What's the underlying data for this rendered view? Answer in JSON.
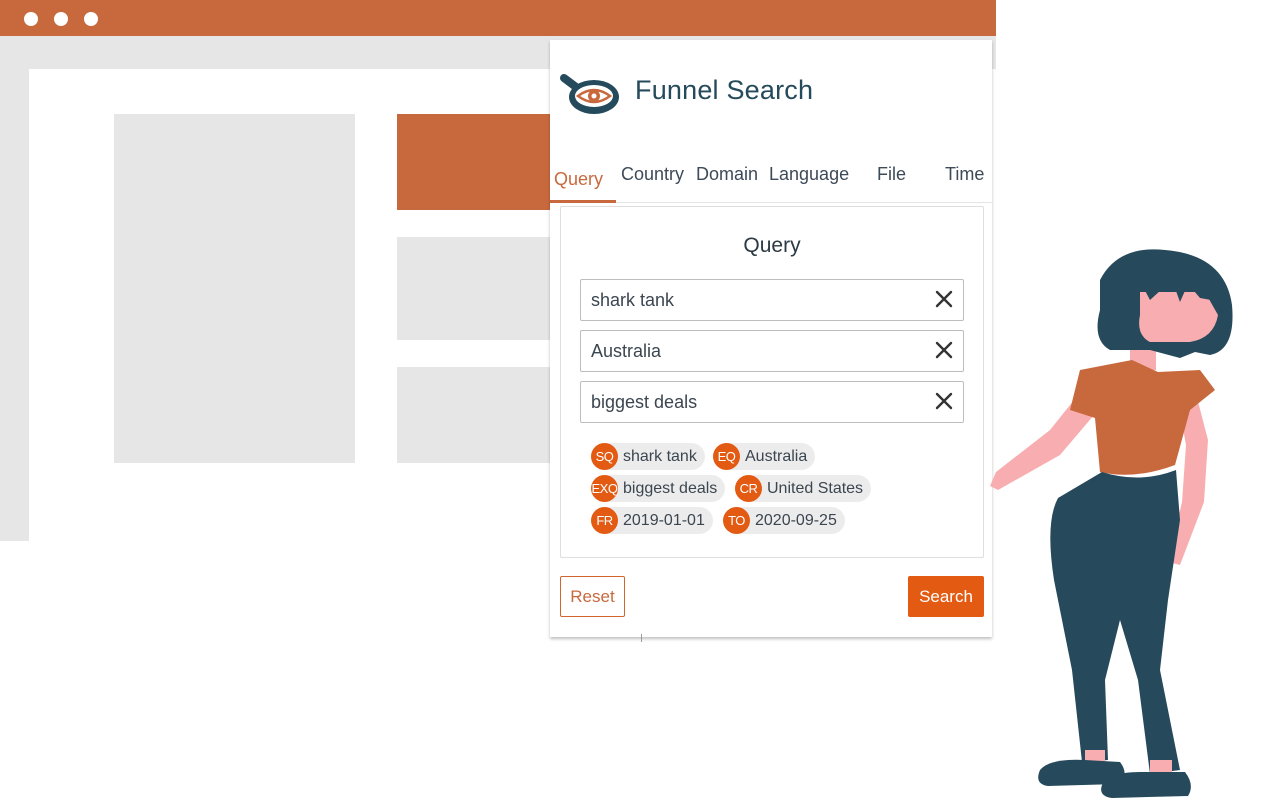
{
  "app": {
    "title": "Funnel Search"
  },
  "tabs": [
    {
      "label": "Query",
      "active": true
    },
    {
      "label": "Country",
      "active": false
    },
    {
      "label": "Domain",
      "active": false
    },
    {
      "label": "Language",
      "active": false
    },
    {
      "label": "File",
      "active": false
    },
    {
      "label": "Time",
      "active": false
    }
  ],
  "panel": {
    "title": "Query",
    "fields": [
      {
        "value": "shark tank"
      },
      {
        "value": "Australia"
      },
      {
        "value": "biggest deals"
      }
    ],
    "chips": [
      {
        "badge": "SQ",
        "label": "shark tank"
      },
      {
        "badge": "EQ",
        "label": "Australia"
      },
      {
        "badge": "EXQ",
        "label": "biggest deals"
      },
      {
        "badge": "CR",
        "label": "United States"
      },
      {
        "badge": "FR",
        "label": "2019-01-01"
      },
      {
        "badge": "TO",
        "label": "2020-09-25"
      }
    ]
  },
  "actions": {
    "reset_label": "Reset",
    "search_label": "Search"
  },
  "colors": {
    "accent": "#c8693d",
    "button": "#e35a12",
    "title_text": "#244a5c",
    "illustration_dark": "#264a5c",
    "illustration_skin": "#f8aeb0"
  },
  "icons": {
    "logo": "magnifier-eye-icon",
    "clear": "close-icon"
  }
}
